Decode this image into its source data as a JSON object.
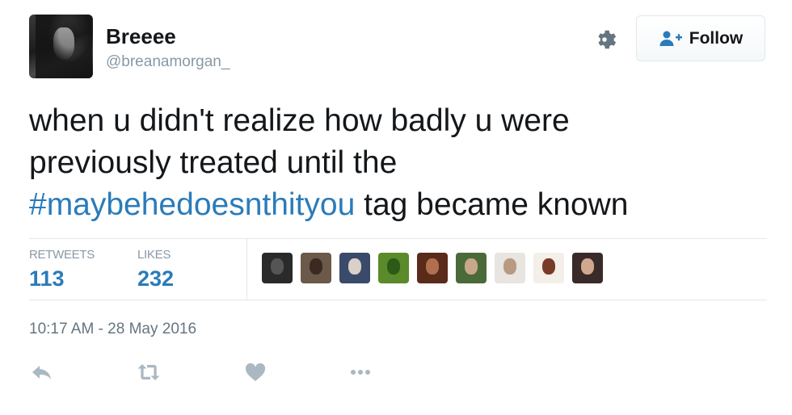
{
  "user": {
    "display_name": "Breeee",
    "handle": "@breanamorgan_"
  },
  "follow_button": {
    "label": "Follow",
    "icon": "add-user-icon"
  },
  "settings_icon": "gear-icon",
  "tweet": {
    "line1": "when u didn't realize how badly u were",
    "line2": "previously treated until the",
    "hashtag": "#maybehedoesnthityou",
    "line3_rest": " tag became known"
  },
  "stats": {
    "retweets_label": "RETWEETS",
    "retweets_count": "113",
    "likes_label": "LIKES",
    "likes_count": "232"
  },
  "likers": [
    {
      "name": "liker-avatar-1",
      "bg": "#2a2a2a",
      "face": "#555555"
    },
    {
      "name": "liker-avatar-2",
      "bg": "#6b5a4a",
      "face": "#3a2a22"
    },
    {
      "name": "liker-avatar-3",
      "bg": "#3a4a6a",
      "face": "#d9d0c8"
    },
    {
      "name": "liker-avatar-4",
      "bg": "#5a8a2a",
      "face": "#2e5a18"
    },
    {
      "name": "liker-avatar-5",
      "bg": "#5a2a1a",
      "face": "#b07050"
    },
    {
      "name": "liker-avatar-6",
      "bg": "#4a6a3a",
      "face": "#c8a888"
    },
    {
      "name": "liker-avatar-7",
      "bg": "#e8e4e0",
      "face": "#b89a80"
    },
    {
      "name": "liker-avatar-8",
      "bg": "#f4efe8",
      "face": "#7a3a2a"
    },
    {
      "name": "liker-avatar-9",
      "bg": "#3a2a2a",
      "face": "#d0a890"
    }
  ],
  "timestamp": "10:17 AM - 28 May 2016",
  "actions": [
    "reply-icon",
    "retweet-icon",
    "like-icon",
    "more-icon"
  ],
  "colors": {
    "link": "#2b7bb9",
    "muted": "#8899a6",
    "icon": "#aab8c2"
  }
}
